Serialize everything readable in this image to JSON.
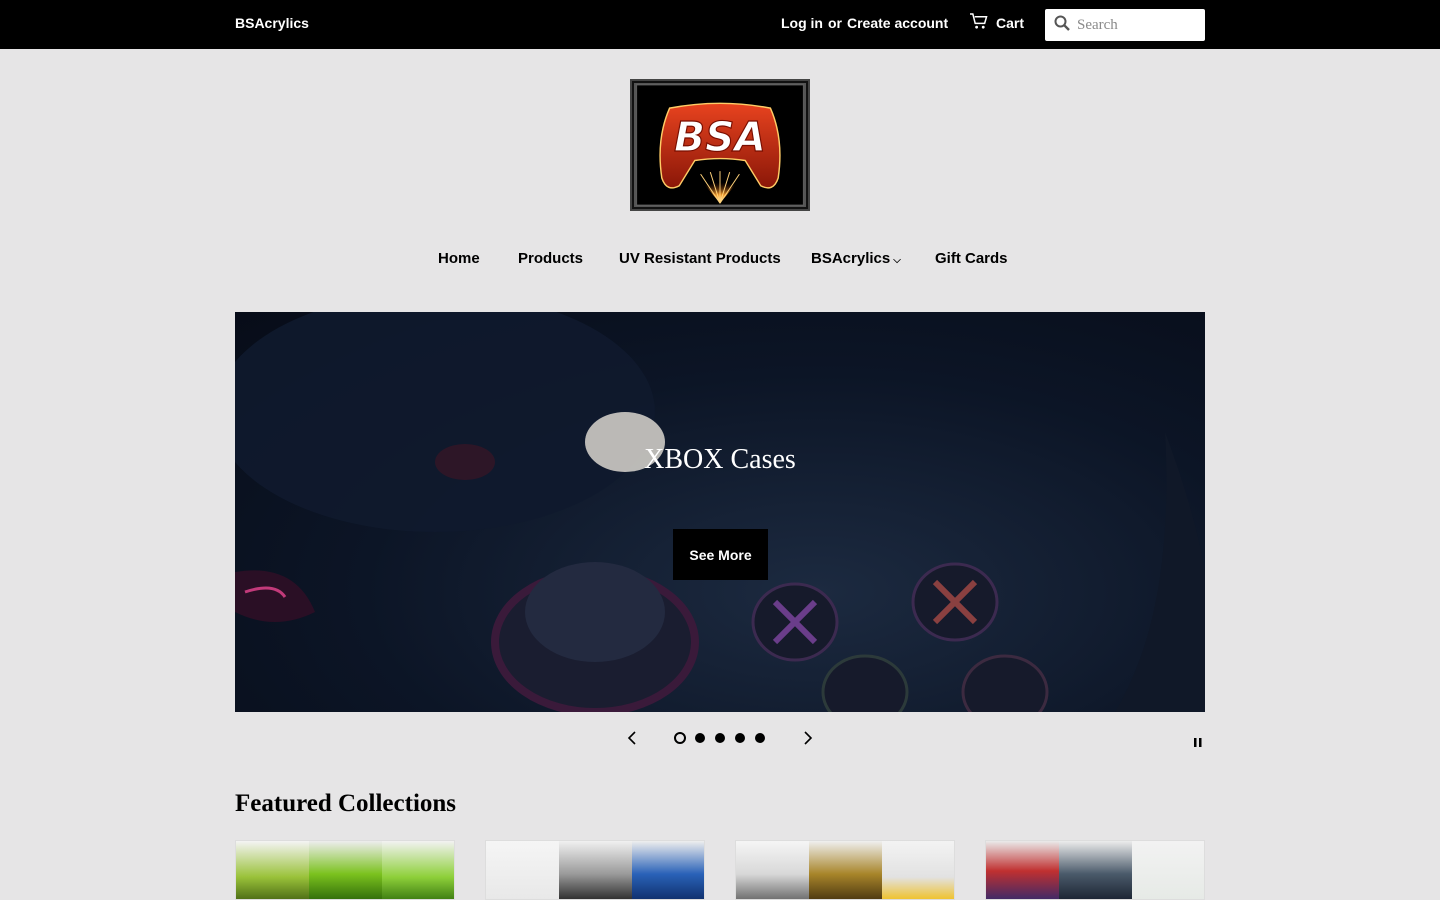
{
  "header": {
    "brand": "BSAcrylics",
    "login": "Log in",
    "or": "or",
    "create_account": "Create account",
    "cart": "Cart",
    "search_placeholder": "Search"
  },
  "logo": {
    "text": "BSA"
  },
  "nav": {
    "items": [
      {
        "label": "Home"
      },
      {
        "label": "Products"
      },
      {
        "label": "UV Resistant Products"
      },
      {
        "label": "BSAcrylics",
        "caret": "⌵"
      },
      {
        "label": "Gift Cards"
      }
    ]
  },
  "hero": {
    "title": "XBOX Cases",
    "button": "See More",
    "slide_count": 5,
    "active_slide": 1
  },
  "featured": {
    "title": "Featured Collections"
  },
  "colors": {
    "page_bg": "#e6e5e6",
    "topbar_bg": "#000000",
    "hero_bg": "#0c1526"
  },
  "icons": [
    "cart-icon",
    "search-icon",
    "chevron-left-icon",
    "chevron-right-icon",
    "pause-icon"
  ]
}
